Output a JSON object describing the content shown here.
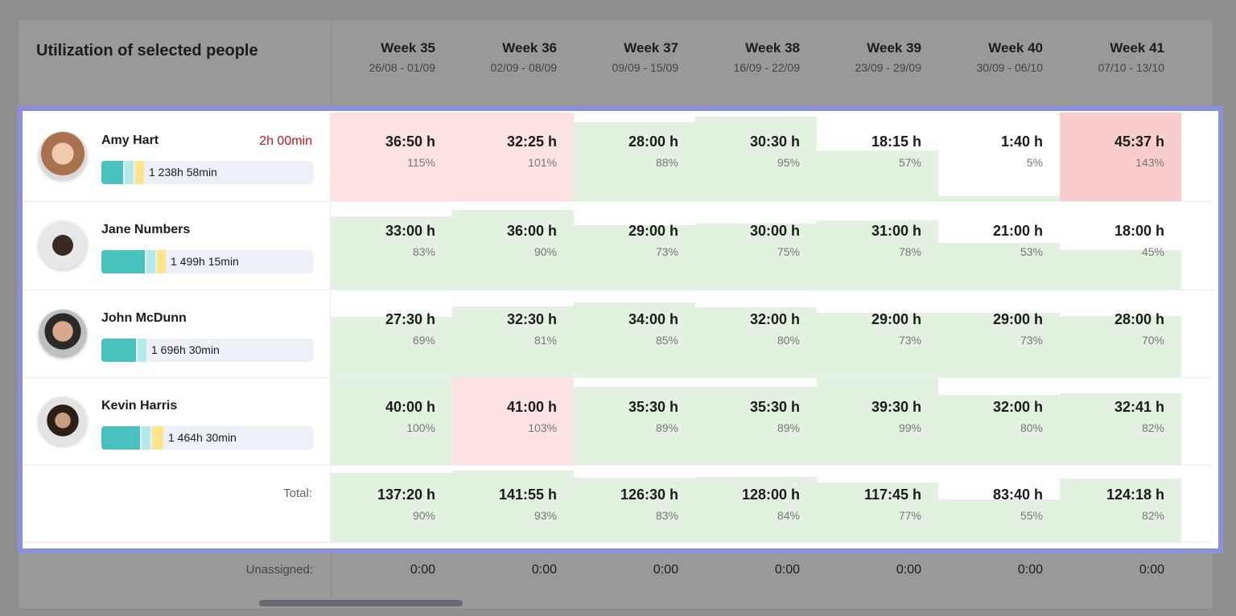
{
  "title": "Utilization of selected people",
  "colors": {
    "teal": "#48c1bf",
    "light_teal": "#b2ebea",
    "yellow": "#fde68a",
    "green_fill": "#e3f1e0",
    "pink_fill": "#fde2e2",
    "red_fill": "#f9cdcd",
    "overtime_text": "#c8161d",
    "highlight_border": "#8a90dc"
  },
  "weeks": [
    {
      "name": "Week 35",
      "dates": "26/08 - 01/09"
    },
    {
      "name": "Week 36",
      "dates": "02/09 - 08/09"
    },
    {
      "name": "Week 37",
      "dates": "09/09 - 15/09"
    },
    {
      "name": "Week 38",
      "dates": "16/09 - 22/09"
    },
    {
      "name": "Week 39",
      "dates": "23/09 - 29/09"
    },
    {
      "name": "Week 40",
      "dates": "30/09 - 06/10"
    },
    {
      "name": "Week 41",
      "dates": "07/10 - 13/10"
    }
  ],
  "people": [
    {
      "name": "Amy Hart",
      "overtime": "2h 00min",
      "total": "1 238h 58min",
      "avatar_icon": "person-photo",
      "cells": [
        {
          "h": "36:50 h",
          "p": "115%",
          "v": 115
        },
        {
          "h": "32:25 h",
          "p": "101%",
          "v": 101
        },
        {
          "h": "28:00 h",
          "p": "88%",
          "v": 88
        },
        {
          "h": "30:30 h",
          "p": "95%",
          "v": 95
        },
        {
          "h": "18:15 h",
          "p": "57%",
          "v": 57
        },
        {
          "h": "1:40 h",
          "p": "5%",
          "v": 5
        },
        {
          "h": "45:37 h",
          "p": "143%",
          "v": 143
        }
      ]
    },
    {
      "name": "Jane Numbers",
      "overtime": "",
      "total": "1 499h 15min",
      "avatar_icon": "person-photo",
      "cells": [
        {
          "h": "33:00 h",
          "p": "83%",
          "v": 83
        },
        {
          "h": "36:00 h",
          "p": "90%",
          "v": 90
        },
        {
          "h": "29:00 h",
          "p": "73%",
          "v": 73
        },
        {
          "h": "30:00 h",
          "p": "75%",
          "v": 75
        },
        {
          "h": "31:00 h",
          "p": "78%",
          "v": 78
        },
        {
          "h": "21:00 h",
          "p": "53%",
          "v": 53
        },
        {
          "h": "18:00 h",
          "p": "45%",
          "v": 45
        }
      ]
    },
    {
      "name": "John McDunn",
      "overtime": "",
      "total": "1 696h 30min",
      "avatar_icon": "person-photo",
      "cells": [
        {
          "h": "27:30 h",
          "p": "69%",
          "v": 69
        },
        {
          "h": "32:30 h",
          "p": "81%",
          "v": 81
        },
        {
          "h": "34:00 h",
          "p": "85%",
          "v": 85
        },
        {
          "h": "32:00 h",
          "p": "80%",
          "v": 80
        },
        {
          "h": "29:00 h",
          "p": "73%",
          "v": 73
        },
        {
          "h": "29:00 h",
          "p": "73%",
          "v": 73
        },
        {
          "h": "28:00 h",
          "p": "70%",
          "v": 70
        }
      ]
    },
    {
      "name": "Kevin Harris",
      "overtime": "",
      "total": "1 464h 30min",
      "avatar_icon": "person-photo",
      "cells": [
        {
          "h": "40:00 h",
          "p": "100%",
          "v": 100
        },
        {
          "h": "41:00 h",
          "p": "103%",
          "v": 103
        },
        {
          "h": "35:30 h",
          "p": "89%",
          "v": 89
        },
        {
          "h": "35:30 h",
          "p": "89%",
          "v": 89
        },
        {
          "h": "39:30 h",
          "p": "99%",
          "v": 99
        },
        {
          "h": "32:00 h",
          "p": "80%",
          "v": 80
        },
        {
          "h": "32:41 h",
          "p": "82%",
          "v": 82
        }
      ]
    }
  ],
  "total": {
    "label": "Total:",
    "cells": [
      {
        "h": "137:20 h",
        "p": "90%",
        "v": 90
      },
      {
        "h": "141:55 h",
        "p": "93%",
        "v": 93
      },
      {
        "h": "126:30 h",
        "p": "83%",
        "v": 83
      },
      {
        "h": "128:00 h",
        "p": "84%",
        "v": 84
      },
      {
        "h": "117:45 h",
        "p": "77%",
        "v": 77
      },
      {
        "h": "83:40 h",
        "p": "55%",
        "v": 55
      },
      {
        "h": "124:18 h",
        "p": "82%",
        "v": 82
      }
    ]
  },
  "unassigned": {
    "label": "Unassigned:",
    "values": [
      "0:00",
      "0:00",
      "0:00",
      "0:00",
      "0:00",
      "0:00",
      "0:00"
    ]
  }
}
